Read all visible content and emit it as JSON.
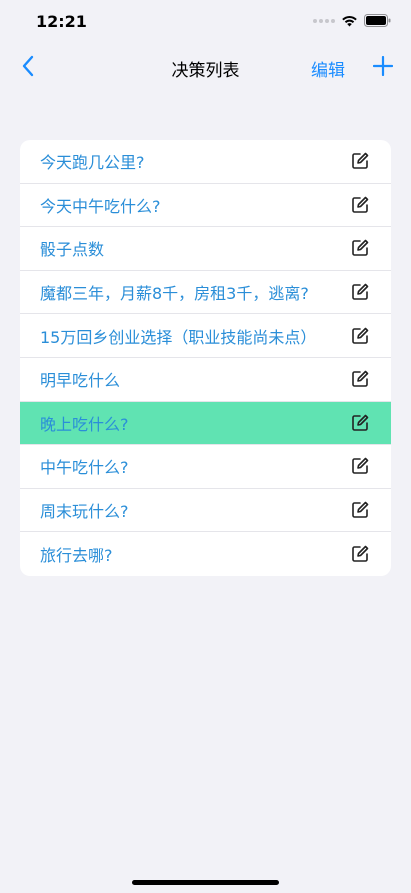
{
  "status_bar": {
    "time": "12:21"
  },
  "nav": {
    "title": "决策列表",
    "edit_label": "编辑",
    "back_icon": "chevron-left-icon",
    "add_icon": "plus-icon"
  },
  "list": {
    "active_color": "#60e3b2",
    "label_color": "#2a8ed8",
    "active_index": 6,
    "items": [
      {
        "label": "今天跑几公里?"
      },
      {
        "label": "今天中午吃什么?"
      },
      {
        "label": "骰子点数"
      },
      {
        "label": "魔都三年，月薪8千，房租3千，逃离?"
      },
      {
        "label": "15万回乡创业选择（职业技能尚未点）"
      },
      {
        "label": "明早吃什么"
      },
      {
        "label": "晚上吃什么?"
      },
      {
        "label": "中午吃什么?"
      },
      {
        "label": "周末玩什么?"
      },
      {
        "label": "旅行去哪?"
      }
    ]
  }
}
